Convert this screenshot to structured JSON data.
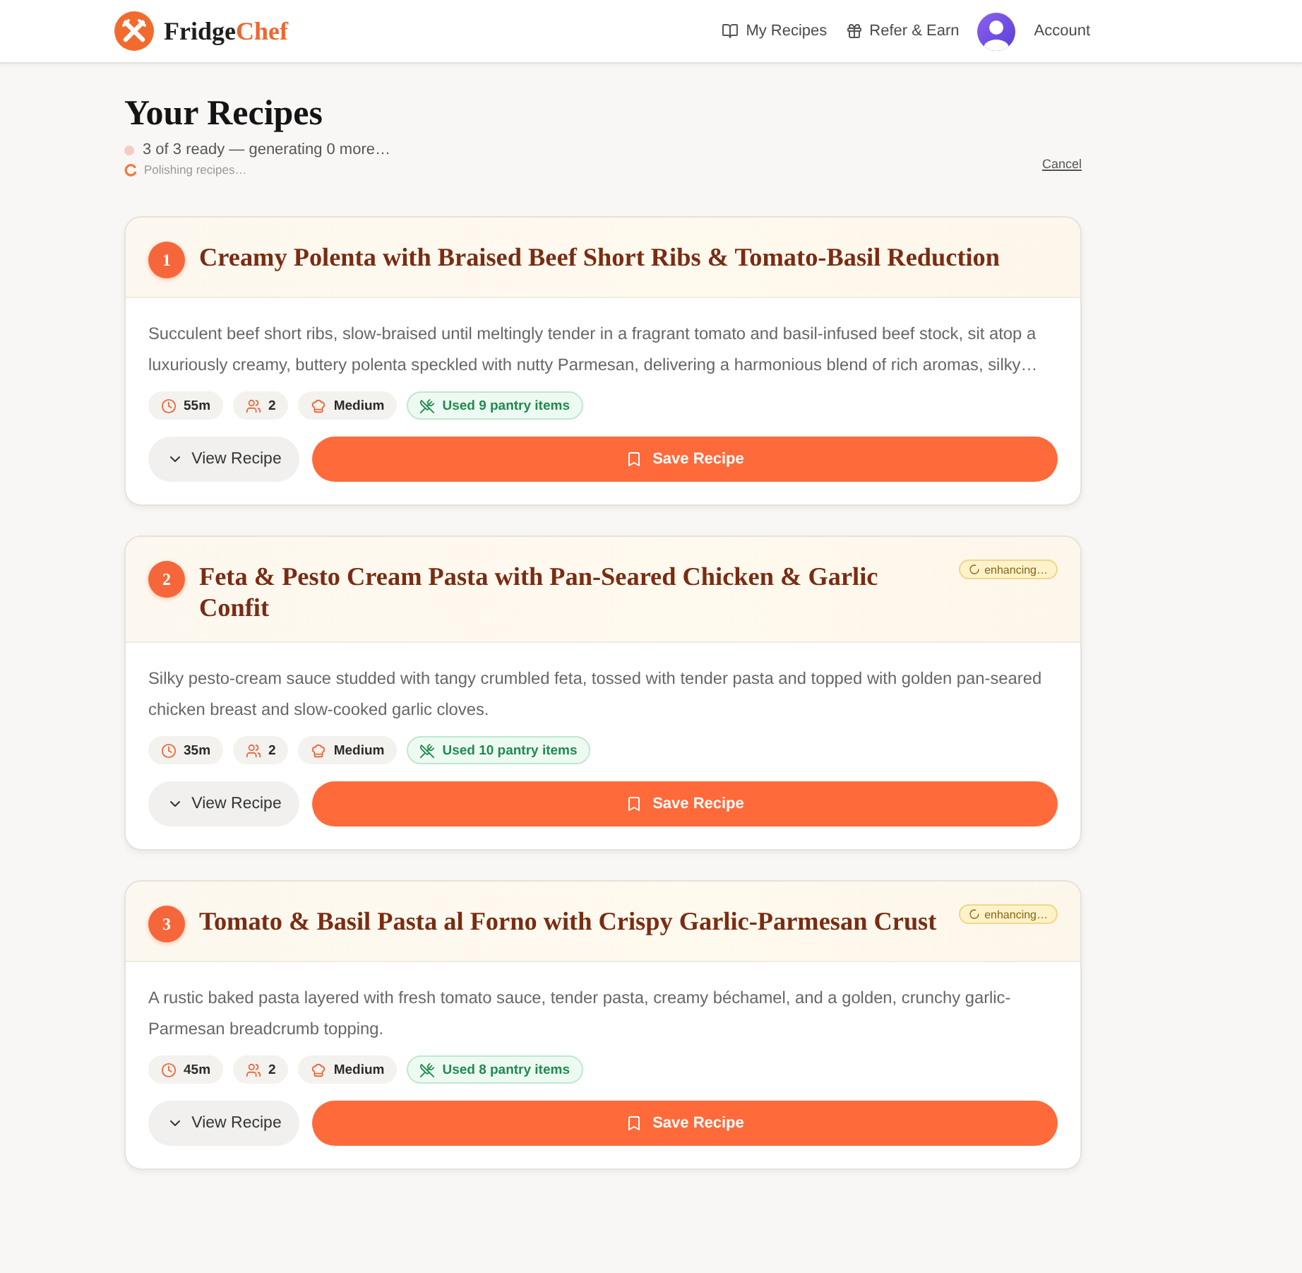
{
  "header": {
    "brand_part_1": "Fridge",
    "brand_part_2": "Chef",
    "nav": [
      {
        "kind": "recipes",
        "label": "My Recipes"
      },
      {
        "kind": "referral",
        "label": "Refer & Earn"
      }
    ],
    "account": {
      "label": "Account"
    }
  },
  "page": {
    "title": "Your Recipes",
    "status": "3 of 3 ready — generating 0 more…",
    "substatus": "Polishing recipes…",
    "cancel": "Cancel"
  },
  "recipes": [
    {
      "number": "1",
      "title": "Creamy Polenta with Braised Beef Short Ribs & Tomato-Basil Reduction",
      "description": "Succulent beef short ribs, slow-braised until meltingly tender in a fragrant tomato and basil-infused beef stock, sit atop a luxuriously creamy, buttery polenta speckled with nutty Parmesan, delivering a harmonious blend of rich aromas, silky…",
      "meta": [
        {
          "kind": "time",
          "text": "55m"
        },
        {
          "kind": "servings",
          "text": "2"
        },
        {
          "kind": "difficulty",
          "text": "Medium"
        },
        {
          "kind": "pantry",
          "text": "Used 9 pantry items"
        }
      ],
      "view_label": "View Recipe",
      "save_label": "Save Recipe"
    },
    {
      "number": "2",
      "title": "Feta & Pesto Cream Pasta with Pan-Seared Chicken & Garlic Confit",
      "badge": "enhancing…",
      "description": "Silky pesto-cream sauce studded with tangy crumbled feta, tossed with tender pasta and topped with golden pan-seared chicken breast and slow-cooked garlic cloves.",
      "meta": [
        {
          "kind": "time",
          "text": "35m"
        },
        {
          "kind": "servings",
          "text": "2"
        },
        {
          "kind": "difficulty",
          "text": "Medium"
        },
        {
          "kind": "pantry",
          "text": "Used 10 pantry items"
        }
      ],
      "view_label": "View Recipe",
      "save_label": "Save Recipe"
    },
    {
      "number": "3",
      "title": "Tomato & Basil Pasta al Forno with Crispy Garlic-Parmesan Crust",
      "badge": "enhancing…",
      "description": "A rustic baked pasta layered with fresh tomato sauce, tender pasta, creamy béchamel, and a golden, crunchy garlic-Parmesan breadcrumb topping.",
      "meta": [
        {
          "kind": "time",
          "text": "45m"
        },
        {
          "kind": "servings",
          "text": "2"
        },
        {
          "kind": "difficulty",
          "text": "Medium"
        },
        {
          "kind": "pantry",
          "text": "Used 8 pantry items"
        }
      ],
      "view_label": "View Recipe",
      "save_label": "Save Recipe"
    }
  ]
}
